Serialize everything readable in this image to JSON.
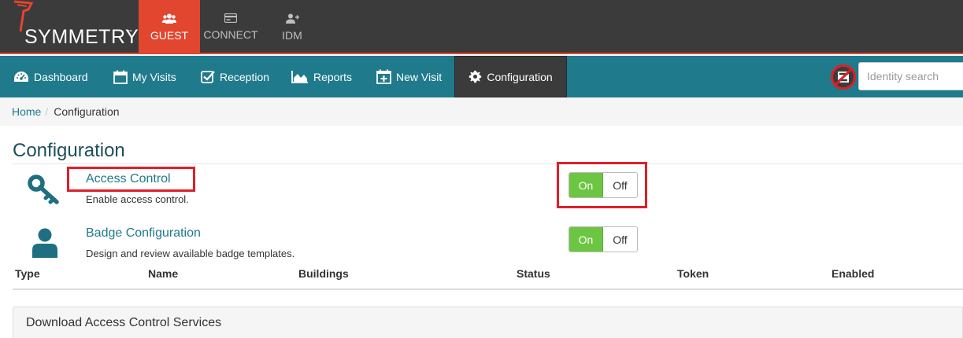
{
  "app": {
    "logo_text": "SYMMETRY",
    "logo_tm": "™",
    "modules": [
      {
        "label": "GUEST",
        "icon": "users-icon",
        "active": true
      },
      {
        "label": "CONNECT",
        "icon": "card-icon",
        "active": false
      },
      {
        "label": "IDM",
        "icon": "user-plus-icon",
        "active": false
      }
    ]
  },
  "nav": {
    "items": [
      {
        "label": "Dashboard",
        "icon": "dashboard-icon"
      },
      {
        "label": "My Visits",
        "icon": "calendar-icon"
      },
      {
        "label": "Reception",
        "icon": "checkbox-icon"
      },
      {
        "label": "Reports",
        "icon": "area-chart-icon"
      },
      {
        "label": "New Visit",
        "icon": "calendar-plus-icon"
      },
      {
        "label": "Configuration",
        "icon": "gear-icon",
        "active": true
      }
    ],
    "search_placeholder": "Identity search"
  },
  "breadcrumb": {
    "home": "Home",
    "separator": "/",
    "current": "Configuration"
  },
  "page": {
    "title": "Configuration"
  },
  "settings": [
    {
      "title": "Access Control",
      "description": "Enable access control.",
      "icon": "key-icon",
      "on_label": "On",
      "off_label": "Off",
      "state": "on"
    },
    {
      "title": "Badge Configuration",
      "description": "Design and review available badge templates.",
      "icon": "user-icon",
      "on_label": "On",
      "off_label": "Off",
      "state": "on"
    }
  ],
  "table": {
    "headers": [
      "Type",
      "Name",
      "Buildings",
      "Status",
      "Token",
      "Enabled"
    ]
  },
  "panel": {
    "title": "Download Access Control Services"
  },
  "colors": {
    "topbar": "#3b3b3b",
    "accent": "#e2462f",
    "nav": "#1f7a8c",
    "toggle_on": "#6cc644",
    "highlight": "#e01e28"
  }
}
